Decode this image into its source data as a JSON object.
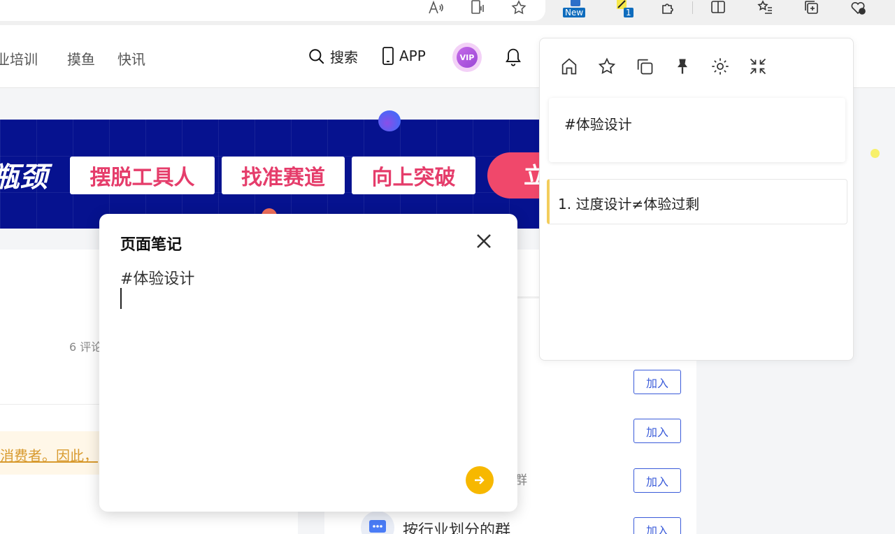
{
  "browser_toolbar": {
    "icons": [
      "read-aloud-icon",
      "immersive-reader-icon",
      "favorite-star-icon",
      "new-extension-icon",
      "pen-extension-icon",
      "extensions-puzzle-icon",
      "split-screen-icon",
      "favorites-list-icon",
      "collections-icon",
      "performance-icon"
    ],
    "new_badge": "New",
    "pen_badge": "1"
  },
  "site_header": {
    "nav_links": [
      "业培训",
      "摸鱼",
      "快讯"
    ],
    "search_label": "搜索",
    "app_label": "APP",
    "vip_label": "VIP"
  },
  "banner": {
    "cut_text": "瓶颈",
    "pills": [
      "摆脱工具人",
      "找准赛道",
      "向上突破"
    ],
    "cta": "立"
  },
  "article": {
    "comment_count": "6 评论",
    "highlight_text": "消费者。因此，"
  },
  "groups": {
    "join_label": "加入",
    "group_title": "按行业划分的群",
    "fragment_char": "群"
  },
  "note_popup": {
    "title": "页面笔记",
    "content": "#体验设计",
    "accent": "#f7b800"
  },
  "side_panel": {
    "toolbar_icons": [
      "home-icon",
      "star-icon",
      "copy-icon",
      "pin-icon",
      "settings-icon",
      "collapse-icon"
    ],
    "note_text": "#体验设计",
    "list_items": [
      "1. 过度设计≠体验过剩"
    ],
    "accent": "#f3cd5c"
  }
}
